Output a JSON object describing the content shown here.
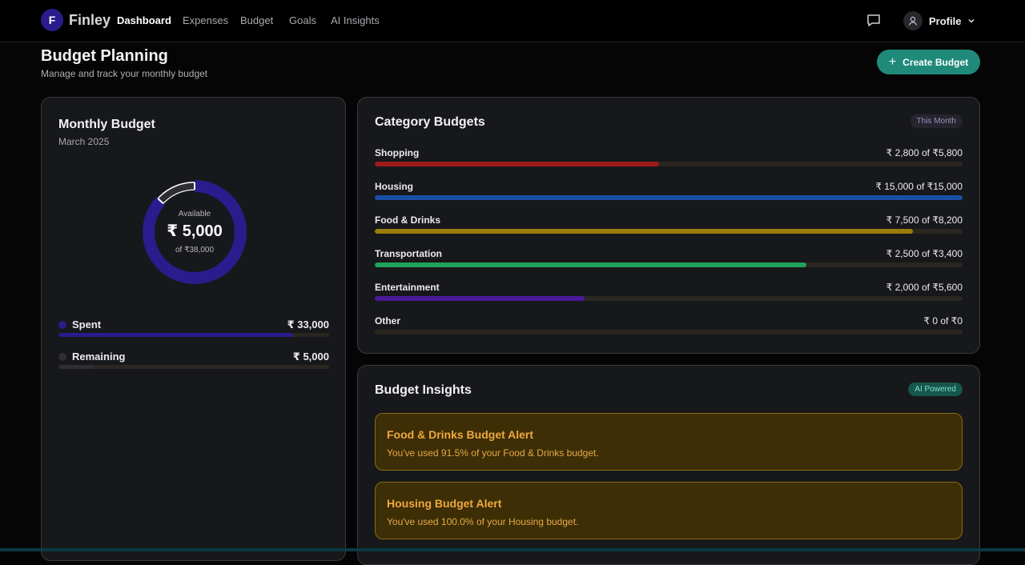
{
  "nav": {
    "logo_letter": "F",
    "app_name": "Finley",
    "links": [
      {
        "label": "Dashboard",
        "active": true
      },
      {
        "label": "Expenses",
        "active": false
      },
      {
        "label": "Budget",
        "active": false
      },
      {
        "label": "Goals",
        "active": false
      },
      {
        "label": "AI Insights",
        "active": false
      }
    ],
    "chat_icon": "chat-bubble-icon",
    "profile_icon": "user-icon",
    "profile_label": "Profile"
  },
  "header": {
    "title": "Budget Planning",
    "subtitle": "Manage and track your monthly budget",
    "create_button": "Create Budget"
  },
  "monthly": {
    "title": "Monthly Budget",
    "period": "March 2025",
    "available_label": "Available",
    "available_amount": "₹ 5,000",
    "of_total": "of ₹38,000",
    "spent_fraction": 0.868,
    "spent_label": "Spent",
    "spent_value": "₹ 33,000",
    "remaining_label": "Remaining",
    "remaining_value": "₹ 5,000",
    "remaining_fraction": 0.132,
    "colors": {
      "spent": "#2a1c8c",
      "remaining": "#2e2e33"
    }
  },
  "categories": {
    "title": "Category Budgets",
    "badge": "This Month",
    "items": [
      {
        "name": "Shopping",
        "value": "₹ 2,800 of ₹5,800",
        "fraction": 0.483,
        "color": "#a11a1a"
      },
      {
        "name": "Housing",
        "value": "₹ 15,000 of ₹15,000",
        "fraction": 1.0,
        "color": "#1a4fa8"
      },
      {
        "name": "Food & Drinks",
        "value": "₹ 7,500 of ₹8,200",
        "fraction": 0.915,
        "color": "#9a7c0a"
      },
      {
        "name": "Transportation",
        "value": "₹ 2,500 of ₹3,400",
        "fraction": 0.735,
        "color": "#1fa35a"
      },
      {
        "name": "Entertainment",
        "value": "₹ 2,000 of ₹5,600",
        "fraction": 0.357,
        "color": "#4a1a9a"
      },
      {
        "name": "Other",
        "value": "₹ 0 of ₹0",
        "fraction": 0.0,
        "color": "#555555"
      }
    ]
  },
  "insights": {
    "title": "Budget Insights",
    "badge": "AI Powered",
    "alerts": [
      {
        "title": "Food & Drinks Budget Alert",
        "text": "You've used 91.5% of your Food & Drinks budget."
      },
      {
        "title": "Housing Budget Alert",
        "text": "You've used 100.0% of your Housing budget."
      }
    ]
  }
}
